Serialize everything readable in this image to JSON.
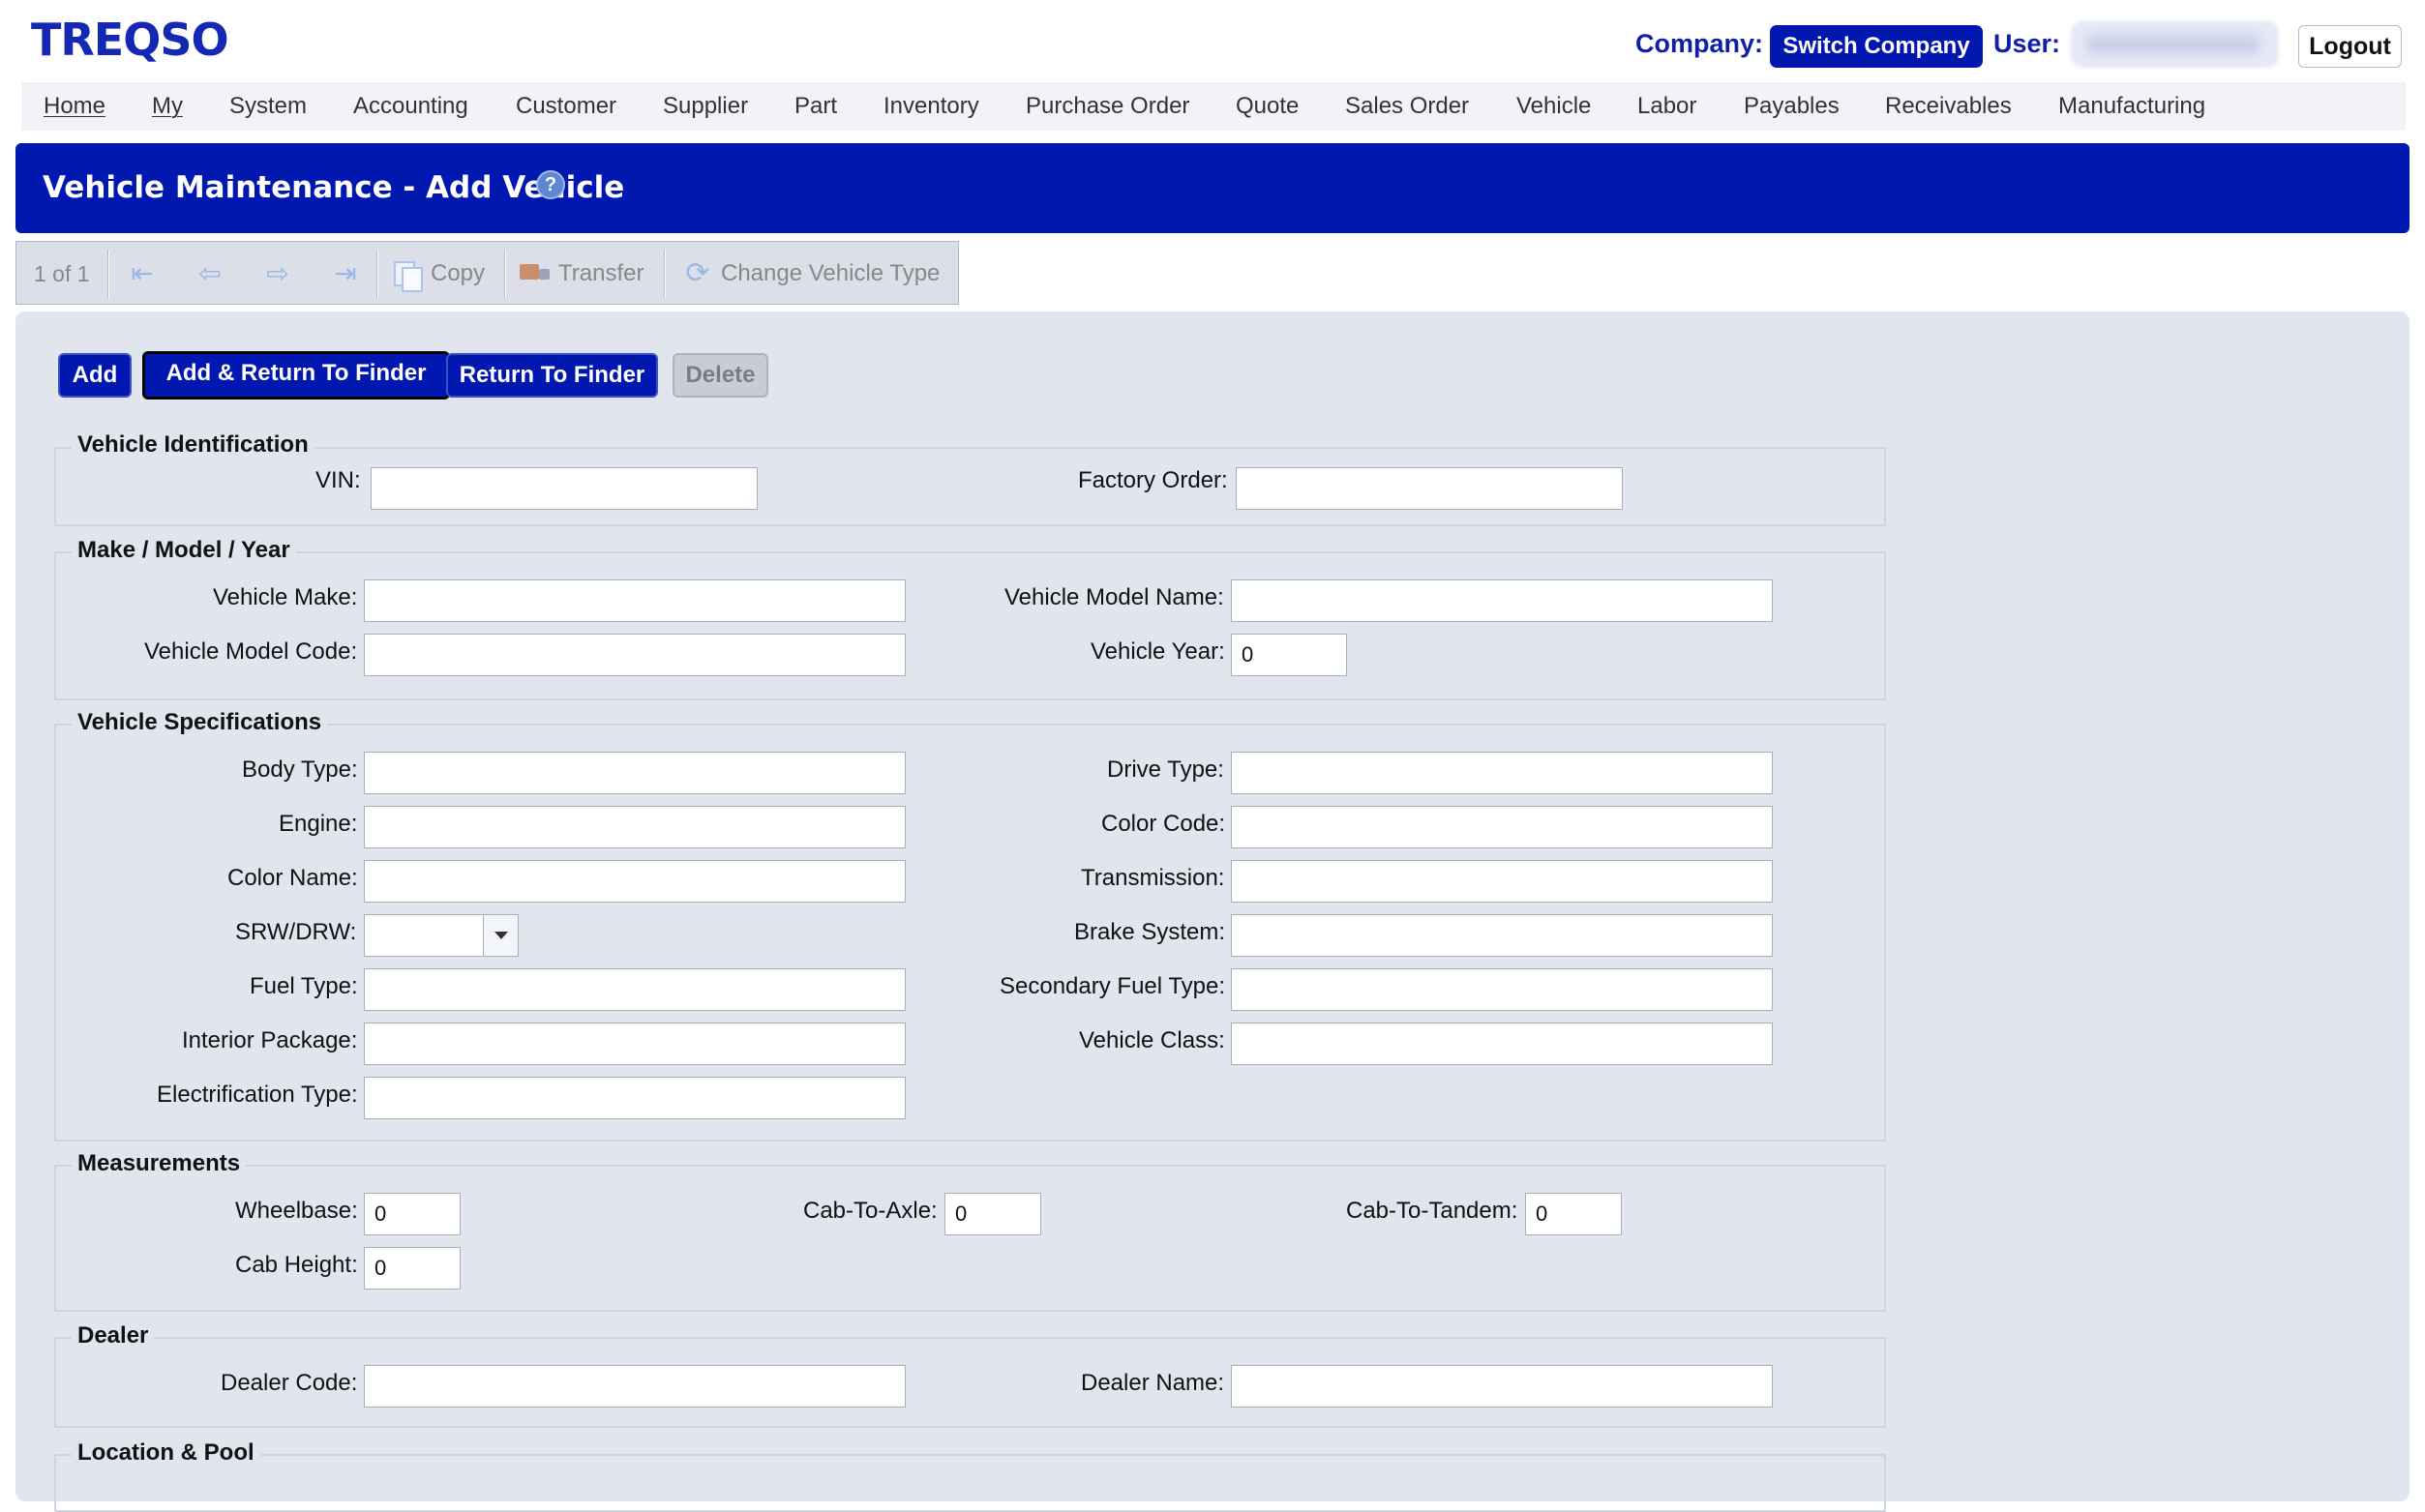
{
  "header": {
    "logo": "TREQSO",
    "company_label": "Company:",
    "switch_company": "Switch Company",
    "user_label": "User:",
    "logout": "Logout"
  },
  "nav": [
    "Home",
    "My",
    "System",
    "Accounting",
    "Customer",
    "Supplier",
    "Part",
    "Inventory",
    "Purchase Order",
    "Quote",
    "Sales Order",
    "Vehicle",
    "Labor",
    "Payables",
    "Receivables",
    "Manufacturing"
  ],
  "page": {
    "title": "Vehicle Maintenance - Add Vehicle",
    "help": "?"
  },
  "toolbar": {
    "counter": "1 of 1",
    "copy": "Copy",
    "transfer": "Transfer",
    "change_type": "Change Vehicle Type"
  },
  "actions": {
    "add": "Add",
    "add_return": "Add & Return To Finder",
    "return": "Return To Finder",
    "delete": "Delete"
  },
  "sections": {
    "identification": {
      "title": "Vehicle Identification",
      "vin": {
        "label": "VIN:",
        "value": ""
      },
      "factory_order": {
        "label": "Factory Order:",
        "value": ""
      }
    },
    "make_model": {
      "title": "Make / Model / Year",
      "make": {
        "label": "Vehicle Make:",
        "value": ""
      },
      "model_name": {
        "label": "Vehicle Model Name:",
        "value": ""
      },
      "model_code": {
        "label": "Vehicle Model Code:",
        "value": ""
      },
      "year": {
        "label": "Vehicle Year:",
        "value": "0"
      }
    },
    "specs": {
      "title": "Vehicle Specifications",
      "body_type": {
        "label": "Body Type:",
        "value": ""
      },
      "drive_type": {
        "label": "Drive Type:",
        "value": ""
      },
      "engine": {
        "label": "Engine:",
        "value": ""
      },
      "color_code": {
        "label": "Color Code:",
        "value": ""
      },
      "color_name": {
        "label": "Color Name:",
        "value": ""
      },
      "transmission": {
        "label": "Transmission:",
        "value": ""
      },
      "srw_drw": {
        "label": "SRW/DRW:",
        "value": ""
      },
      "brake_system": {
        "label": "Brake System:",
        "value": ""
      },
      "fuel_type": {
        "label": "Fuel Type:",
        "value": ""
      },
      "secondary_fuel": {
        "label": "Secondary Fuel Type:",
        "value": ""
      },
      "interior_package": {
        "label": "Interior Package:",
        "value": ""
      },
      "vehicle_class": {
        "label": "Vehicle Class:",
        "value": ""
      },
      "electrification": {
        "label": "Electrification Type:",
        "value": ""
      }
    },
    "measurements": {
      "title": "Measurements",
      "wheelbase": {
        "label": "Wheelbase:",
        "value": "0"
      },
      "cab_to_axle": {
        "label": "Cab-To-Axle:",
        "value": "0"
      },
      "cab_to_tandem": {
        "label": "Cab-To-Tandem:",
        "value": "0"
      },
      "cab_height": {
        "label": "Cab Height:",
        "value": "0"
      }
    },
    "dealer": {
      "title": "Dealer",
      "code": {
        "label": "Dealer Code:",
        "value": ""
      },
      "name": {
        "label": "Dealer Name:",
        "value": ""
      }
    },
    "location": {
      "title": "Location & Pool"
    }
  },
  "colors": {
    "brand_blue": "#0018b0",
    "panel_bg": "#e0e5ee"
  }
}
